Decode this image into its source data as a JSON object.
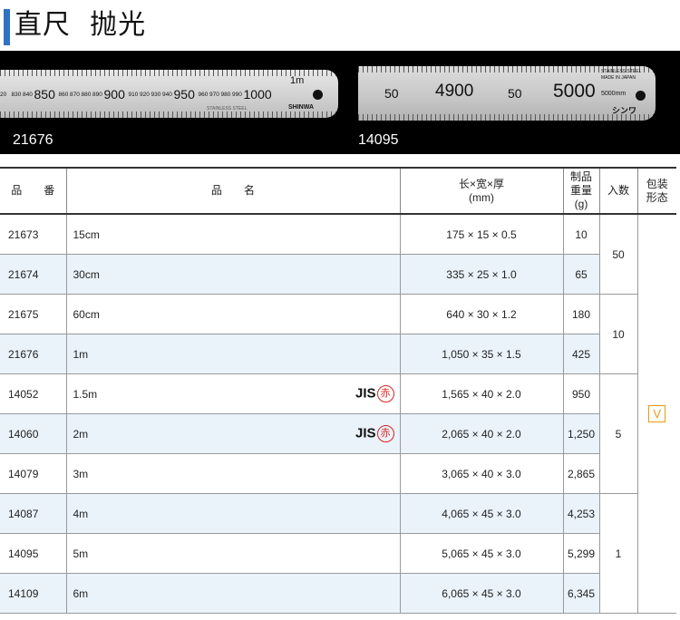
{
  "title": "直尺  抛光",
  "photos": {
    "ruler1": {
      "code": "21676",
      "numbers": [
        "20",
        "830",
        "840",
        "850",
        "860",
        "870",
        "880",
        "890",
        "900",
        "910",
        "920",
        "930",
        "940",
        "950",
        "960",
        "970",
        "980",
        "990",
        "1000"
      ],
      "end_label": "1m",
      "small_label": "STAINLESS STEEL",
      "brand": "SHINWA"
    },
    "ruler2": {
      "code": "14095",
      "numbers": [
        "50",
        "4900",
        "50",
        "5000"
      ],
      "unit_label": "5000mm",
      "label1": "STAINLESS STEEL",
      "label2": "MADE IN JAPAN",
      "brand": "シンワ"
    }
  },
  "table": {
    "headers": {
      "code": "品　　番",
      "name": "品　　名",
      "dims_line1": "长×宽×厚",
      "dims_line2": "(mm)",
      "weight_line1": "制品",
      "weight_line2": "重量",
      "weight_line3": "(g)",
      "qty": "入数",
      "pack_line1": "包装",
      "pack_line2": "形态"
    },
    "rows": [
      {
        "code": "21673",
        "name": "15cm",
        "dims": "175 × 15 × 0.5",
        "weight": "10"
      },
      {
        "code": "21674",
        "name": "30cm",
        "dims": "335 × 25 × 1.0",
        "weight": "65"
      },
      {
        "code": "21675",
        "name": "60cm",
        "dims": "640 × 30 × 1.2",
        "weight": "180"
      },
      {
        "code": "21676",
        "name": "1m",
        "dims": "1,050 × 35 × 1.5",
        "weight": "425"
      },
      {
        "code": "14052",
        "name": "1.5m",
        "jis": "JIS",
        "jis_mark": "赤",
        "dims": "1,565 × 40 × 2.0",
        "weight": "950"
      },
      {
        "code": "14060",
        "name": "2m",
        "jis": "JIS",
        "jis_mark": "赤",
        "dims": "2,065 × 40 × 2.0",
        "weight": "1,250"
      },
      {
        "code": "14079",
        "name": "3m",
        "dims": "3,065 × 40 × 3.0",
        "weight": "2,865"
      },
      {
        "code": "14087",
        "name": "4m",
        "dims": "4,065 × 45 × 3.0",
        "weight": "4,253"
      },
      {
        "code": "14095",
        "name": "5m",
        "dims": "5,065 × 45 × 3.0",
        "weight": "5,299"
      },
      {
        "code": "14109",
        "name": "6m",
        "dims": "6,065 × 45 × 3.0",
        "weight": "6,345"
      }
    ],
    "qty_groups": [
      "50",
      "10",
      "5",
      "1"
    ],
    "pack": "V"
  },
  "colors": {
    "accent": "#2f72c4",
    "row_alt": "#eaf3fa",
    "jis_red": "#d22222",
    "pack_orange": "#e89a0e"
  }
}
